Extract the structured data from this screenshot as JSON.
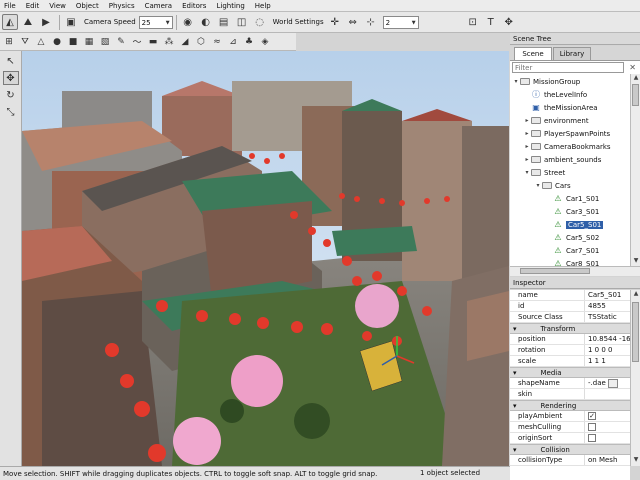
{
  "menubar": {
    "items": [
      "File",
      "Edit",
      "View",
      "Object",
      "Physics",
      "Camera",
      "Editors",
      "Lighting",
      "Help"
    ]
  },
  "toolbar": {
    "camera_speed_label": "Camera Speed",
    "camera_speed_value": "25",
    "world_settings_label": "World Settings",
    "grid_size_value": "2",
    "icons_row1": [
      "terrain-editor-icon",
      "world-editor-icon",
      "play-game-icon",
      "camera-icon",
      "globe-icon",
      "toggle-visibility-icon",
      "lock-icon",
      "object-bounds-icon",
      "reset-icon",
      "snap-icon",
      "fit-icon",
      "render-icon",
      "text-icon",
      "pan-icon"
    ],
    "icons_row2": [
      "terrain-icon",
      "heightmap-icon",
      "sphere-icon",
      "cube-icon",
      "grid-icon",
      "texture-icon",
      "paint-icon",
      "smooth-icon",
      "flatten-icon",
      "noise-icon",
      "erosion-icon",
      "mesh-icon",
      "river-icon",
      "road-icon",
      "forest-icon",
      "decal-icon"
    ]
  },
  "left_tools": [
    "select-arrow-icon",
    "move-gizmo-icon",
    "rotate-gizmo-icon",
    "scale-gizmo-icon"
  ],
  "status": {
    "hint": "Move selection.  SHIFT while dragging duplicates objects.  CTRL to toggle soft snap.  ALT to toggle grid snap.",
    "selection": "1 object selected"
  },
  "scene_tree": {
    "title": "Scene Tree",
    "tabs": [
      "Scene",
      "Library"
    ],
    "filter_placeholder": "Filter",
    "items": [
      {
        "label": "MissionGroup",
        "icon": "folder",
        "twisty": "▾",
        "indent": 0
      },
      {
        "label": "theLevelInfo",
        "icon": "info",
        "twisty": "",
        "indent": 1
      },
      {
        "label": "theMissionArea",
        "icon": "area",
        "twisty": "",
        "indent": 1
      },
      {
        "label": "environment",
        "icon": "folder",
        "twisty": "▸",
        "indent": 1
      },
      {
        "label": "PlayerSpawnPoints",
        "icon": "folder",
        "twisty": "▸",
        "indent": 1
      },
      {
        "label": "CameraBookmarks",
        "icon": "folder",
        "twisty": "▸",
        "indent": 1
      },
      {
        "label": "ambient_sounds",
        "icon": "folder",
        "twisty": "▸",
        "indent": 1
      },
      {
        "label": "Street",
        "icon": "folder",
        "twisty": "▾",
        "indent": 1
      },
      {
        "label": "Cars",
        "icon": "folder",
        "twisty": "▾",
        "indent": 2
      },
      {
        "label": "Car1_S01",
        "icon": "shape",
        "twisty": "",
        "indent": 3
      },
      {
        "label": "Car3_S01",
        "icon": "shape",
        "twisty": "",
        "indent": 3
      },
      {
        "label": "Car5_S01",
        "icon": "shape",
        "twisty": "",
        "indent": 3,
        "selected": true
      },
      {
        "label": "Car5_S02",
        "icon": "shape",
        "twisty": "",
        "indent": 3
      },
      {
        "label": "Car7_S01",
        "icon": "shape",
        "twisty": "",
        "indent": 3
      },
      {
        "label": "Car8_S01",
        "icon": "shape",
        "twisty": "",
        "indent": 3
      }
    ]
  },
  "inspector": {
    "title": "Inspector",
    "rows": [
      {
        "type": "field",
        "key": "name",
        "value": "Car5_S01"
      },
      {
        "type": "field",
        "key": "id",
        "value": "4855"
      },
      {
        "type": "field",
        "key": "Source Class",
        "value": "TSStatic"
      },
      {
        "type": "group",
        "key": "Transform"
      },
      {
        "type": "field",
        "key": "position",
        "value": "10.8544 -16"
      },
      {
        "type": "field",
        "key": "rotation",
        "value": "1 0 0 0"
      },
      {
        "type": "field",
        "key": "scale",
        "value": "1 1 1"
      },
      {
        "type": "group",
        "key": "Media"
      },
      {
        "type": "field",
        "key": "shapeName",
        "value": "-.dae",
        "button": true
      },
      {
        "type": "field",
        "key": "skin",
        "value": ""
      },
      {
        "type": "group",
        "key": "Rendering"
      },
      {
        "type": "check",
        "key": "playAmbient",
        "checked": true
      },
      {
        "type": "check",
        "key": "meshCulling",
        "checked": false
      },
      {
        "type": "check",
        "key": "originSort",
        "checked": false
      },
      {
        "type": "group",
        "key": "Collision"
      },
      {
        "type": "field",
        "key": "collisionType",
        "value": "on Mesh"
      }
    ]
  },
  "colors": {
    "sky": "#c9dcef",
    "selection": "#2f5fa8",
    "lantern": "#e2392b",
    "blossom": "#f0a8cf"
  }
}
